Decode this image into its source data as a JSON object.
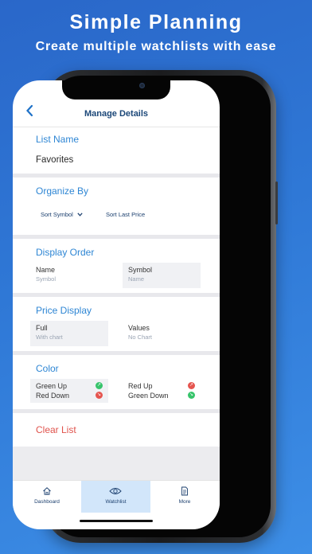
{
  "promo": {
    "title": "Simple Planning",
    "subtitle": "Create multiple watchlists with ease"
  },
  "nav": {
    "back_icon": "chevron-left-icon",
    "title": "Manage Details"
  },
  "list_name": {
    "heading": "List Name",
    "value": "Favorites"
  },
  "organize_by": {
    "heading": "Organize By",
    "sort_symbol": "Sort Symbol",
    "sort_last_price": "Sort Last Price"
  },
  "display_order": {
    "heading": "Display Order",
    "option1": {
      "label": "Name",
      "sub": "Symbol"
    },
    "option2": {
      "label": "Symbol",
      "sub": "Name"
    }
  },
  "price_display": {
    "heading": "Price Display",
    "option1": {
      "label": "Full",
      "sub": "With chart"
    },
    "option2": {
      "label": "Values",
      "sub": "No Chart"
    }
  },
  "color": {
    "heading": "Color",
    "option1": {
      "up": "Green Up",
      "down": "Red Down"
    },
    "option2": {
      "up": "Red Up",
      "down": "Green Down"
    },
    "green": "#37c46b",
    "red": "#e5554f"
  },
  "clear_list": "Clear List",
  "tabs": [
    {
      "label": "Dashboard",
      "icon": "home-icon"
    },
    {
      "label": "Watchlist",
      "icon": "eye-icon"
    },
    {
      "label": "More",
      "icon": "document-icon"
    }
  ],
  "colors": {
    "accent": "#2e86d4",
    "danger": "#e0534c",
    "title": "#1b4778"
  }
}
